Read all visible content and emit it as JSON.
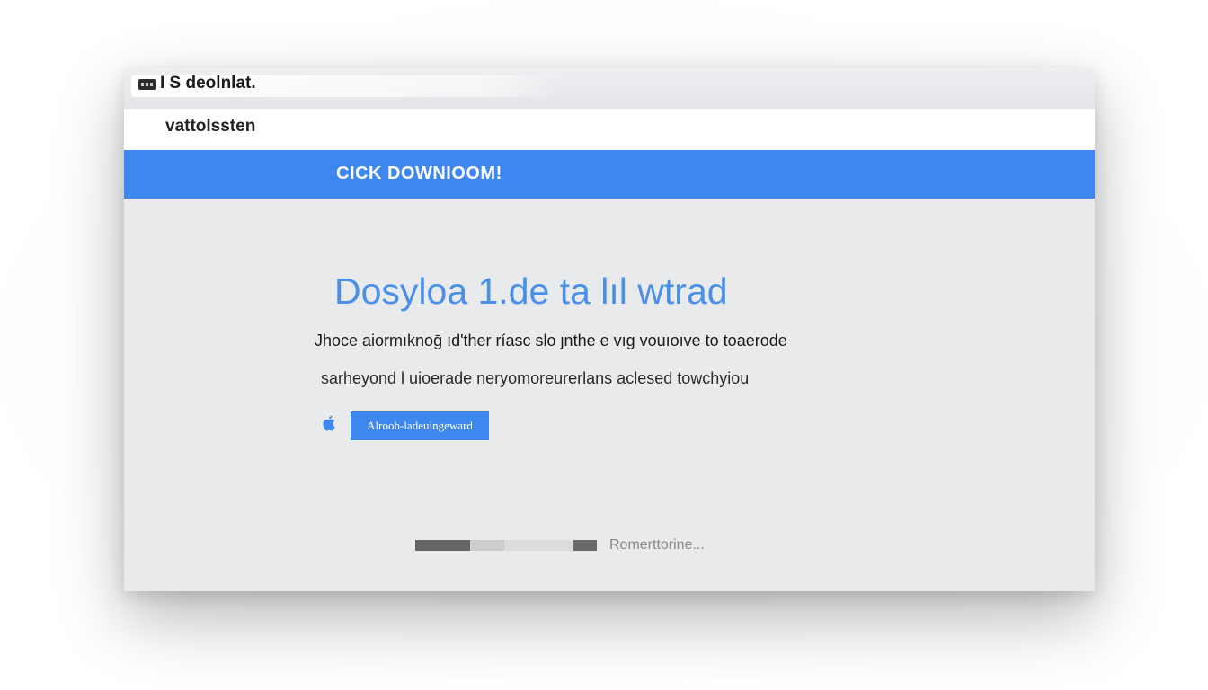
{
  "window": {
    "title": "I S deolnlat."
  },
  "header": {
    "brand": "vattolssten"
  },
  "banner": {
    "text": "CICK DOWNIOOM!"
  },
  "main": {
    "headline": "Dosyloa 1.de ta lıl wtrad",
    "paragraph_1": "Jhoce aiormıknoḡ ıd'ther ríasc slo ȷnthe e vıg vouıoıve to toaerode",
    "paragraph_2": "sarheyond l uioerade neryomoreurerlans aclesed towchyiou",
    "os_icon": "apple-icon",
    "download_button_label": "Alrooh-ladeuingeward"
  },
  "progress": {
    "fraction": 0.3,
    "label": "Romerttorine..."
  },
  "colors": {
    "accent": "#3d87ef",
    "headline": "#4a90e8",
    "background": "#e9eaec"
  }
}
